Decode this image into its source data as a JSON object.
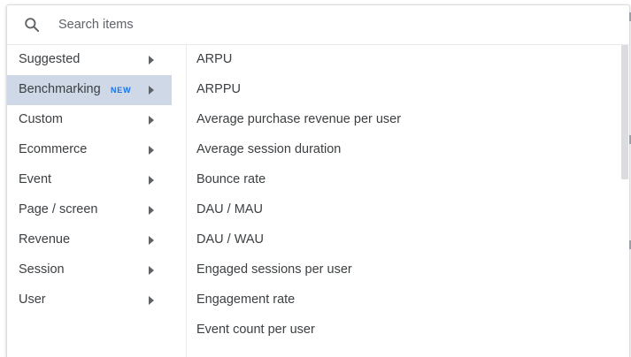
{
  "search": {
    "placeholder": "Search items",
    "icon": "search-icon"
  },
  "categories": [
    {
      "label": "Suggested",
      "selected": false,
      "badge": ""
    },
    {
      "label": "Benchmarking",
      "selected": true,
      "badge": "NEW"
    },
    {
      "label": "Custom",
      "selected": false,
      "badge": ""
    },
    {
      "label": "Ecommerce",
      "selected": false,
      "badge": ""
    },
    {
      "label": "Event",
      "selected": false,
      "badge": ""
    },
    {
      "label": "Page / screen",
      "selected": false,
      "badge": ""
    },
    {
      "label": "Revenue",
      "selected": false,
      "badge": ""
    },
    {
      "label": "Session",
      "selected": false,
      "badge": ""
    },
    {
      "label": "User",
      "selected": false,
      "badge": ""
    }
  ],
  "metrics": [
    "ARPU",
    "ARPPU",
    "Average purchase revenue per user",
    "Average session duration",
    "Bounce rate",
    "DAU / MAU",
    "DAU / WAU",
    "Engaged sessions per user",
    "Engagement rate",
    "Event count per user"
  ],
  "colors": {
    "selected_background": "#cfd8e6",
    "badge": "#1a73e8",
    "text": "#3c4043"
  }
}
